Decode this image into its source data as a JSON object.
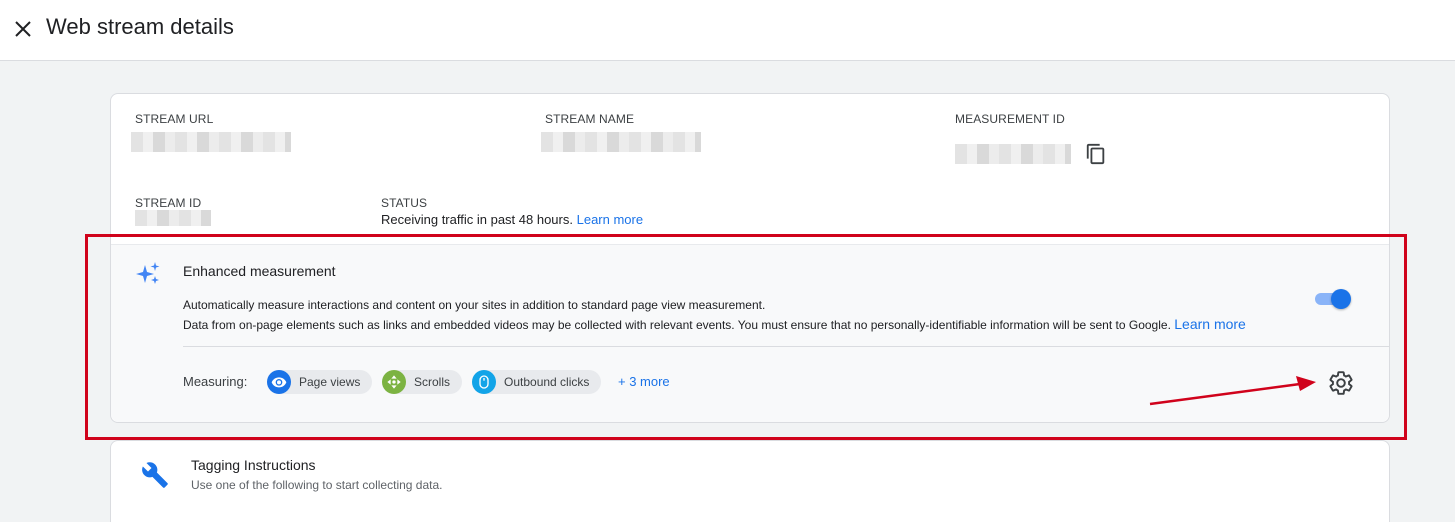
{
  "header": {
    "title": "Web stream details",
    "close_icon": "close-icon"
  },
  "stream": {
    "url_label": "STREAM URL",
    "name_label": "STREAM NAME",
    "measurement_id_label": "MEASUREMENT ID",
    "stream_id_label": "STREAM ID",
    "status_label": "STATUS",
    "status_text": "Receiving traffic in past 48 hours.",
    "status_link": "Learn more",
    "copy_icon": "copy-icon"
  },
  "enhanced": {
    "icon": "sparkle-icon",
    "title": "Enhanced measurement",
    "desc1": "Automatically measure interactions and content on your sites in addition to standard page view measurement.",
    "desc2": "Data from on-page elements such as links and embedded videos may be collected with relevant events. You must ensure that no personally-identifiable information will be sent to Google.",
    "desc2_link": "Learn more",
    "toggle_on": true,
    "measuring_label": "Measuring:",
    "chips": [
      {
        "label": "Page views",
        "icon": "eye-icon",
        "color": "#1a73e8"
      },
      {
        "label": "Scrolls",
        "icon": "scroll-icon",
        "color": "#7cb342"
      },
      {
        "label": "Outbound clicks",
        "icon": "mouse-icon",
        "color": "#12a4e8"
      }
    ],
    "more_link": "+ 3 more",
    "settings_icon": "gear-icon"
  },
  "tagging": {
    "icon": "wrench-icon",
    "title": "Tagging Instructions",
    "subtitle": "Use one of the following to start collecting data."
  },
  "colors": {
    "accent": "#1a73e8",
    "annotation": "#d0021b"
  }
}
